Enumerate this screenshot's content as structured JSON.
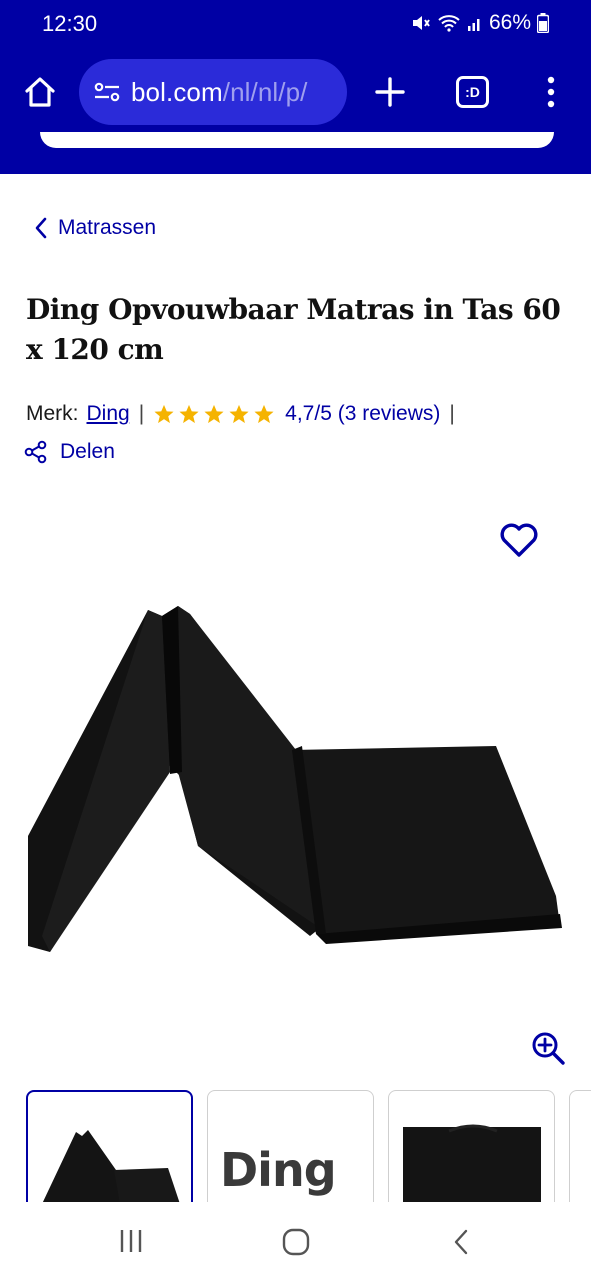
{
  "status_bar": {
    "time": "12:30",
    "battery": "66%"
  },
  "browser": {
    "url_main": "bol.com",
    "url_path": "/nl/nl/p/",
    "tabs_label": ":D"
  },
  "breadcrumb": {
    "label": "Matrassen"
  },
  "product": {
    "title": "Ding Opvouwbaar Matras in Tas 60 x 120 cm",
    "brand_prefix": "Merk:",
    "brand": "Ding",
    "separator": "|",
    "rating_value": 4.7,
    "rating_text": "4,7/5 (3 reviews)",
    "share_label": "Delen"
  },
  "thumbnails": [
    {
      "kind": "product-folded"
    },
    {
      "kind": "brand-logo",
      "text": "Ding"
    },
    {
      "kind": "product-bag"
    }
  ],
  "colors": {
    "brand_blue": "#0000a4",
    "star_yellow": "#f5b301"
  }
}
